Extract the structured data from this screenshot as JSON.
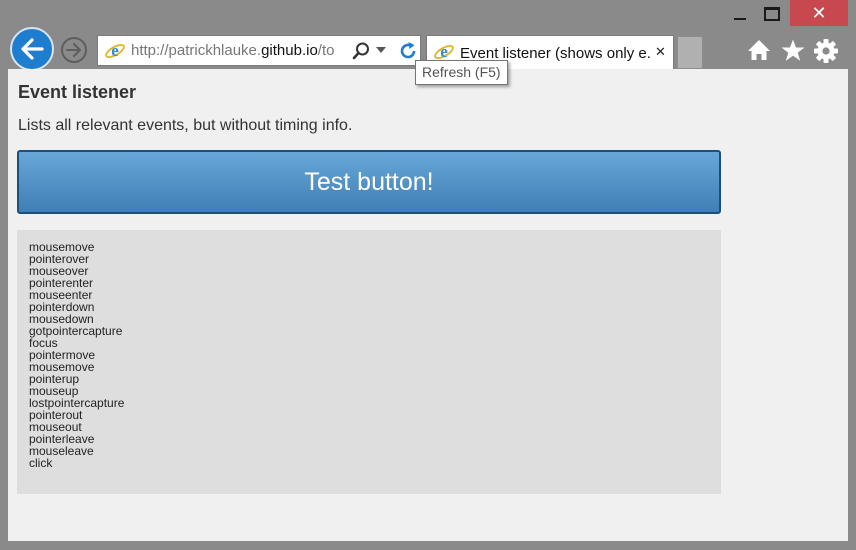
{
  "window": {
    "minimize_label": "minimize",
    "maximize_label": "maximize",
    "close_glyph": "✕"
  },
  "toolbar": {
    "back_icon": "back-arrow-icon",
    "forward_icon": "forward-arrow-icon"
  },
  "address": {
    "url_prefix": "http://patrickhlauke.",
    "url_domain": "github.io",
    "url_rest": "/to",
    "icons": [
      "ie-logo-icon",
      "search-icon",
      "chevron-down-icon",
      "refresh-icon"
    ]
  },
  "tab": {
    "title": "Event listener (shows only e...",
    "close_glyph": "✕"
  },
  "tooltip": {
    "text": "Refresh (F5)"
  },
  "command_icons": [
    "home-icon",
    "favorites-star-icon",
    "settings-gear-icon"
  ],
  "page": {
    "title": "Event listener",
    "description": "Lists all relevant events, but without timing info.",
    "button_label": "Test button!",
    "events": [
      "mousemove",
      "pointerover",
      "mouseover",
      "pointerenter",
      "mouseenter",
      "pointerdown",
      "mousedown",
      "gotpointercapture",
      "focus",
      "pointermove",
      "mousemove",
      "pointerup",
      "mouseup",
      "lostpointercapture",
      "pointerout",
      "mouseout",
      "pointerleave",
      "mouseleave",
      "click"
    ]
  },
  "colors": {
    "window_frame": "#8a8a8a",
    "close_button": "#c7484f",
    "back_button": "#1f7dcf",
    "test_button_top": "#67a7d8",
    "test_button_bottom": "#3f7fb5",
    "log_background": "#dedede",
    "page_background": "#f0f0f0"
  }
}
